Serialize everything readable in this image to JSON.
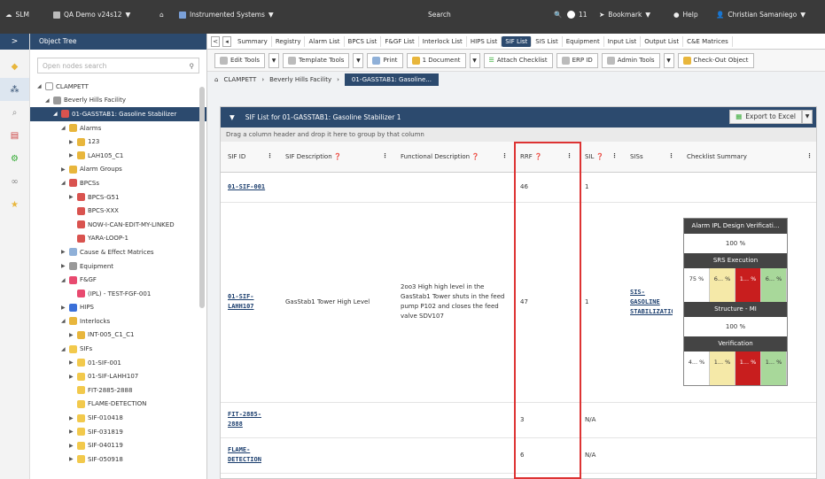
{
  "colors": {
    "topbar": "#3a3a3a",
    "nav": "#2c4a6e",
    "red_box": "#d33333",
    "white": "#ffffff",
    "amber": "#f5e9a8",
    "red": "#c81e1e",
    "green": "#a8d89a"
  },
  "topbar": {
    "app": "SLM",
    "project": "QA Demo v24s12",
    "home_icon": "home-icon",
    "system": "Instrumented Systems",
    "search": "Search",
    "notif_count": "11",
    "bookmark": "Bookmark",
    "help": "Help",
    "user": "Christian Samaniego"
  },
  "leftnav": {
    "toggle": ">",
    "icons": [
      "cube-icon",
      "tree-icon",
      "search-icon",
      "report-icon",
      "gear-icon",
      "link-icon",
      "star-icon"
    ]
  },
  "tree": {
    "title": "Object Tree",
    "search_placeholder": "Open nodes search",
    "nodes": [
      {
        "arrow": "◢",
        "label": "CLAMPETT",
        "icon": "#ffffff",
        "indent": 0
      },
      {
        "arrow": "◢",
        "label": "Beverly Hills Facility",
        "icon": "#9a9a9a",
        "indent": 1
      },
      {
        "arrow": "◢",
        "label": "01-GASSTAB1: Gasoline Stabilizer",
        "icon": "#d9534f",
        "indent": 2,
        "selected": true
      },
      {
        "arrow": "◢",
        "label": "Alarms",
        "icon": "#e8b63c",
        "indent": 3
      },
      {
        "arrow": "▶",
        "label": "123",
        "icon": "#e8b63c",
        "indent": 4
      },
      {
        "arrow": "▶",
        "label": "LAH105_C1",
        "icon": "#e8b63c",
        "indent": 4
      },
      {
        "arrow": "▶",
        "label": "Alarm Groups",
        "icon": "#e8b63c",
        "indent": 3
      },
      {
        "arrow": "◢",
        "label": "BPCSs",
        "icon": "#d9534f",
        "indent": 3
      },
      {
        "arrow": "▶",
        "label": "BPCS-G51",
        "icon": "#d9534f",
        "indent": 4
      },
      {
        "arrow": "",
        "label": "BPCS-XXX",
        "icon": "#d9534f",
        "indent": 4
      },
      {
        "arrow": "",
        "label": "NOW-I-CAN-EDIT-MY-LINKED",
        "icon": "#d9534f",
        "indent": 4
      },
      {
        "arrow": "",
        "label": "YARA-LOOP-1",
        "icon": "#d9534f",
        "indent": 4
      },
      {
        "arrow": "▶",
        "label": "Cause & Effect Matrices",
        "icon": "#8fb0d8",
        "indent": 3
      },
      {
        "arrow": "▶",
        "label": "Equipment",
        "icon": "#999999",
        "indent": 3
      },
      {
        "arrow": "◢",
        "label": "F&GF",
        "icon": "#e84a6f",
        "indent": 3
      },
      {
        "arrow": "",
        "label": "(IPL) - TEST-FGF-001",
        "icon": "#e84a6f",
        "indent": 4
      },
      {
        "arrow": "▶",
        "label": "HIPS",
        "icon": "#3a6fd8",
        "indent": 3
      },
      {
        "arrow": "◢",
        "label": "Interlocks",
        "icon": "#e8b63c",
        "indent": 3
      },
      {
        "arrow": "▶",
        "label": "INT-005_C1_C1",
        "icon": "#e8b63c",
        "indent": 4
      },
      {
        "arrow": "◢",
        "label": "SIFs",
        "icon": "#f2c94c",
        "indent": 3
      },
      {
        "arrow": "▶",
        "label": "01-SIF-001",
        "icon": "#f2c94c",
        "indent": 4
      },
      {
        "arrow": "▶",
        "label": "01-SIF-LAHH107",
        "icon": "#f2c94c",
        "indent": 4
      },
      {
        "arrow": "",
        "label": "FIT-2885-2888",
        "icon": "#f2c94c",
        "indent": 4
      },
      {
        "arrow": "",
        "label": "FLAME-DETECTION",
        "icon": "#f2c94c",
        "indent": 4
      },
      {
        "arrow": "▶",
        "label": "SIF-010418",
        "icon": "#f2c94c",
        "indent": 4
      },
      {
        "arrow": "▶",
        "label": "SIF-031819",
        "icon": "#f2c94c",
        "indent": 4
      },
      {
        "arrow": "▶",
        "label": "SIF-040119",
        "icon": "#f2c94c",
        "indent": 4
      },
      {
        "arrow": "▶",
        "label": "SIF-050918",
        "icon": "#f2c94c",
        "indent": 4
      }
    ]
  },
  "tabs": [
    "Summary",
    "Registry",
    "Alarm List",
    "BPCS List",
    "F&GF List",
    "Interlock List",
    "HIPS List",
    "SIF List",
    "SIS List",
    "Equipment",
    "Input List",
    "Output List",
    "C&E Matrices"
  ],
  "active_tab": "SIF List",
  "toolbar": {
    "edit_tools": "Edit Tools",
    "template_tools": "Template Tools",
    "print": "Print",
    "document": "1 Document",
    "attach_checklist": "Attach Checklist",
    "erp_id": "ERP ID",
    "admin_tools": "Admin Tools",
    "checkout": "Check-Out Object"
  },
  "breadcrumb": [
    "CLAMPETT",
    "Beverly Hills Facility",
    "01-GASSTAB1: Gasoline..."
  ],
  "panel": {
    "title": "SIF List for 01-GASSTAB1: Gasoline Stabilizer 1",
    "export": "Export to Excel",
    "group_hint": "Drag a column header and drop it here to group by that column"
  },
  "columns": [
    "SIF ID",
    "SIF Description",
    "Functional Description",
    "RRF",
    "SIL",
    "SISs",
    "Checklist Summary"
  ],
  "rows": [
    {
      "id": "01-SIF-001",
      "desc": "",
      "func": "",
      "rrf": "46",
      "sil": "1",
      "sis": ""
    },
    {
      "id": "01-SIF-LAHH107",
      "desc": "GasStab1 Tower High Level",
      "func": "2oo3 High high level in the GasStab1 Tower shuts in the feed pump P102 and closes the feed valve SDV107",
      "rrf": "47",
      "sil": "1",
      "sis": "SIS-GASOLINE STABILIZATION 1"
    },
    {
      "id": "FIT-2885-2888",
      "desc": "",
      "func": "",
      "rrf": "3",
      "sil": "N/A",
      "sis": ""
    },
    {
      "id": "FLAME-DETECTION",
      "desc": "",
      "func": "",
      "rrf": "6",
      "sil": "N/A",
      "sis": ""
    }
  ],
  "checklist": {
    "sections": [
      {
        "title": "Alarm IPL Design Verificati...",
        "value": "100 %"
      },
      {
        "title": "SRS Execution",
        "quad": [
          "75 %",
          "6... %",
          "1... %",
          "6... %"
        ]
      },
      {
        "title": "Structure - MI",
        "value": "100 %"
      },
      {
        "title": "Verification",
        "quad": [
          "4... %",
          "1... %",
          "1... %",
          "1... %"
        ]
      }
    ]
  }
}
